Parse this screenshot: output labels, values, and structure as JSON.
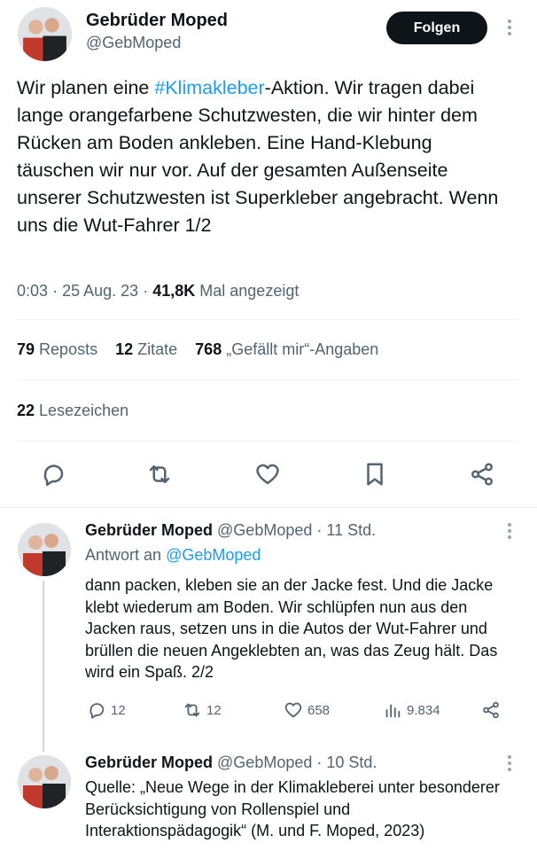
{
  "tweet": {
    "author_name": "Gebrüder Moped",
    "author_handle": "@GebMoped",
    "follow_label": "Folgen",
    "text_before": "Wir planen eine ",
    "hashtag": "#Klimakleber",
    "text_after": "-Aktion. Wir tragen dabei lange orangefarbene Schutzwesten, die wir hinter dem Rücken am Boden ankleben. Eine Hand-Klebung täuschen wir nur vor. Auf der gesamten Außenseite unserer Schutzwesten ist Superkleber angebracht. Wenn uns die Wut-Fahrer 1/2",
    "time": "0:03",
    "date": "25 Aug. 23",
    "views": "41,8K",
    "views_label": "Mal angezeigt",
    "sep": "·"
  },
  "stats": {
    "reposts_count": "79",
    "reposts_label": "Reposts",
    "quotes_count": "12",
    "quotes_label": "Zitate",
    "likes_count": "768",
    "likes_label": "„Gefällt mir“-Angaben",
    "bookmarks_count": "22",
    "bookmarks_label": "Lesezeichen"
  },
  "actions": [
    "reply-icon",
    "repost-icon",
    "like-icon",
    "bookmark-icon",
    "share-icon"
  ],
  "replies": [
    {
      "name": "Gebrüder Moped",
      "handle": "@GebMoped",
      "time": "11 Std.",
      "reply_to_label": "Antwort an",
      "reply_to_handle": "@GebMoped",
      "text": "dann packen, kleben sie an der Jacke fest. Und die Jacke klebt wiederum am Boden. Wir schlüpfen nun aus den Jacken raus, setzen uns in die Autos der Wut-Fahrer und brüllen die neuen Angeklebten an, was das Zeug hält. Das wird ein Spaß. 2/2",
      "replies_count": "12",
      "reposts_count": "12",
      "likes_count": "658",
      "views_count": "9.834"
    },
    {
      "name": "Gebrüder Moped",
      "handle": "@GebMoped",
      "time": "10 Std.",
      "text": "Quelle: „Neue Wege in der Klimakleberei unter besonderer Berücksichtigung von Rollenspiel und Interaktionspädagogik“ (M. und F. Moped, 2023)"
    }
  ],
  "colors": {
    "accent": "#1d9bf0",
    "text": "#0f1419",
    "secondary": "#536471",
    "border": "#eff3f4"
  }
}
